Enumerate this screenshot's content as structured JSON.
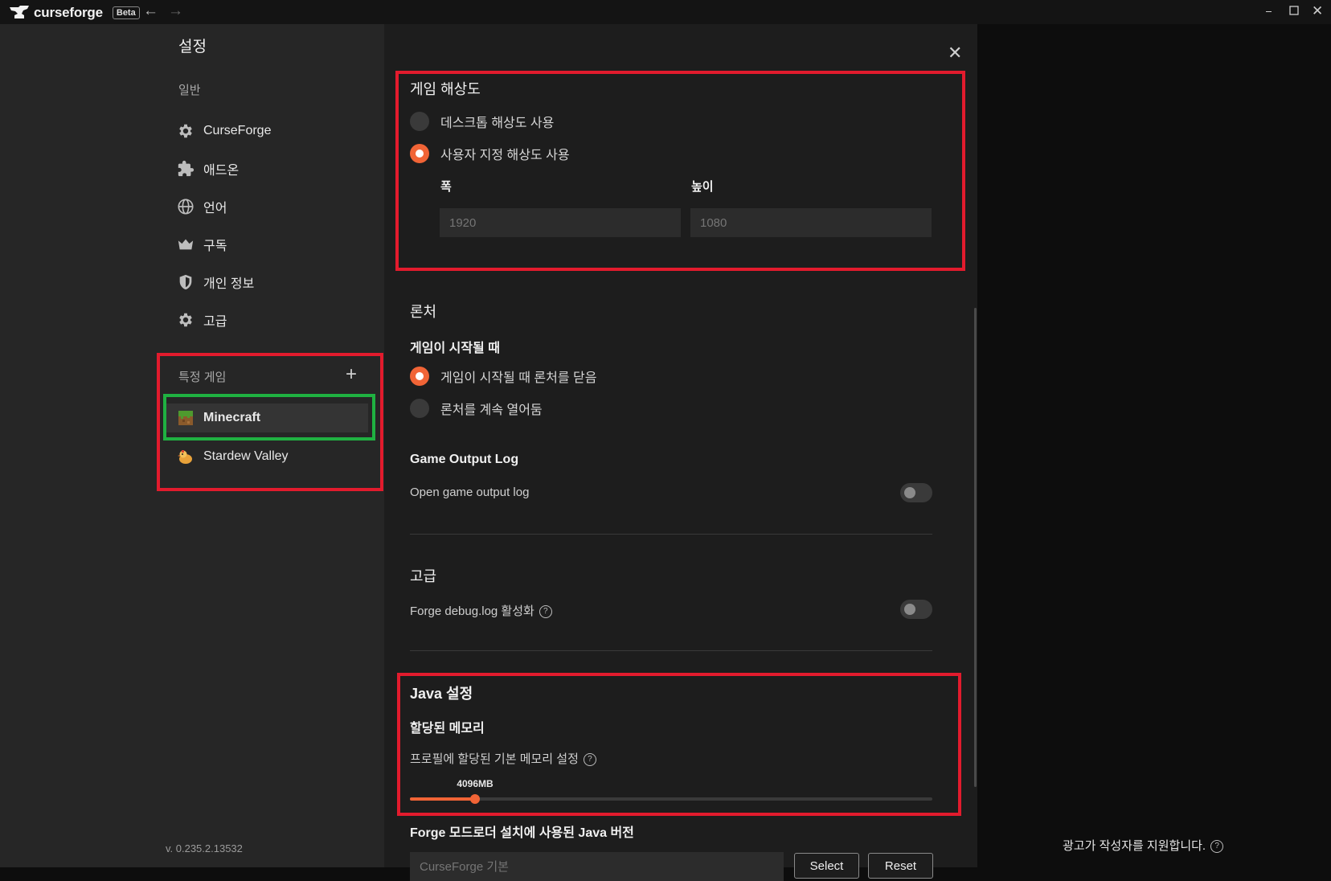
{
  "app": {
    "name": "curseforge",
    "badge": "Beta"
  },
  "sidebar": {
    "title": "설정",
    "general_label": "일반",
    "items": [
      {
        "label": "CurseForge",
        "icon": "gear-icon"
      },
      {
        "label": "애드온",
        "icon": "puzzle-icon"
      },
      {
        "label": "언어",
        "icon": "globe-icon"
      },
      {
        "label": "구독",
        "icon": "crown-icon"
      },
      {
        "label": "개인 정보",
        "icon": "shield-icon"
      },
      {
        "label": "고급",
        "icon": "gear-icon"
      }
    ],
    "games_label": "특정 게임",
    "games": [
      {
        "label": "Minecraft",
        "icon": "minecraft-icon",
        "selected": true
      },
      {
        "label": "Stardew Valley",
        "icon": "stardew-icon",
        "selected": false
      }
    ],
    "version": "v. 0.235.2.13532"
  },
  "resolution": {
    "title": "게임 해상도",
    "options": [
      {
        "label": "데스크톱 해상도 사용",
        "selected": false
      },
      {
        "label": "사용자 지정 해상도 사용",
        "selected": true
      }
    ],
    "width_label": "폭",
    "height_label": "높이",
    "width_placeholder": "1920",
    "height_placeholder": "1080"
  },
  "launcher": {
    "title": "론처",
    "subtitle": "게임이 시작될 때",
    "options": [
      {
        "label": "게임이 시작될 때 론처를 닫음",
        "selected": true
      },
      {
        "label": "론처를 계속 열어둠",
        "selected": false
      }
    ]
  },
  "output_log": {
    "title": "Game Output Log",
    "label": "Open game output log",
    "enabled": false
  },
  "advanced": {
    "title": "고급",
    "label": "Forge debug.log 활성화",
    "help": "?",
    "enabled": false
  },
  "java": {
    "title": "Java 설정",
    "memory_title": "할당된 메모리",
    "memory_desc": "프로필에 할당된 기본 메모리 설정",
    "help": "?",
    "memory_value": "4096MB",
    "memory_fraction": 0.125,
    "version_title": "Forge 모드로더 설치에 사용된 Java 버전",
    "version_placeholder": "CurseForge 기본",
    "select_label": "Select",
    "reset_label": "Reset"
  },
  "ad": {
    "text": "광고가 작성자를 지원합니다.",
    "help": "?"
  },
  "colors": {
    "accent": "#f16436",
    "highlight_red": "#e21b2d",
    "highlight_green": "#1fb141"
  }
}
